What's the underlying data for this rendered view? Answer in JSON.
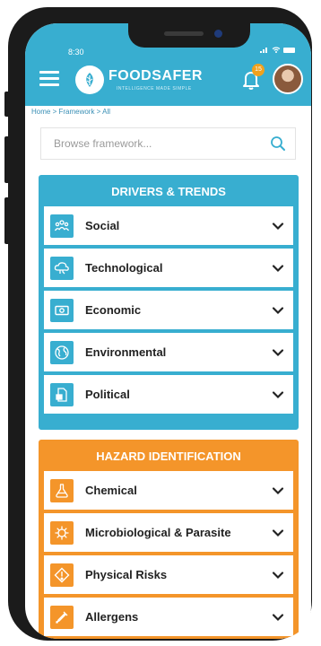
{
  "status_bar": {
    "time": "8:30"
  },
  "header": {
    "brand": "FOODSAFER",
    "brand_sub": "INTELLIGENCE MADE SIMPLE",
    "notification_count": "15"
  },
  "breadcrumb": "Home > Framework > All",
  "search": {
    "placeholder": "Browse framework..."
  },
  "sections": [
    {
      "title": "DRIVERS & TRENDS",
      "color": "#38aed0",
      "items": [
        {
          "label": "Social",
          "icon": "people-icon"
        },
        {
          "label": "Technological",
          "icon": "cloud-tech-icon"
        },
        {
          "label": "Economic",
          "icon": "money-icon"
        },
        {
          "label": "Environmental",
          "icon": "globe-icon"
        },
        {
          "label": "Political",
          "icon": "document-icon"
        }
      ]
    },
    {
      "title": "HAZARD IDENTIFICATION",
      "color": "#f4952a",
      "items": [
        {
          "label": "Chemical",
          "icon": "flask-icon"
        },
        {
          "label": "Microbiological & Parasite",
          "icon": "virus-icon"
        },
        {
          "label": "Physical Risks",
          "icon": "warning-icon"
        },
        {
          "label": "Allergens",
          "icon": "dropper-icon"
        }
      ]
    }
  ]
}
